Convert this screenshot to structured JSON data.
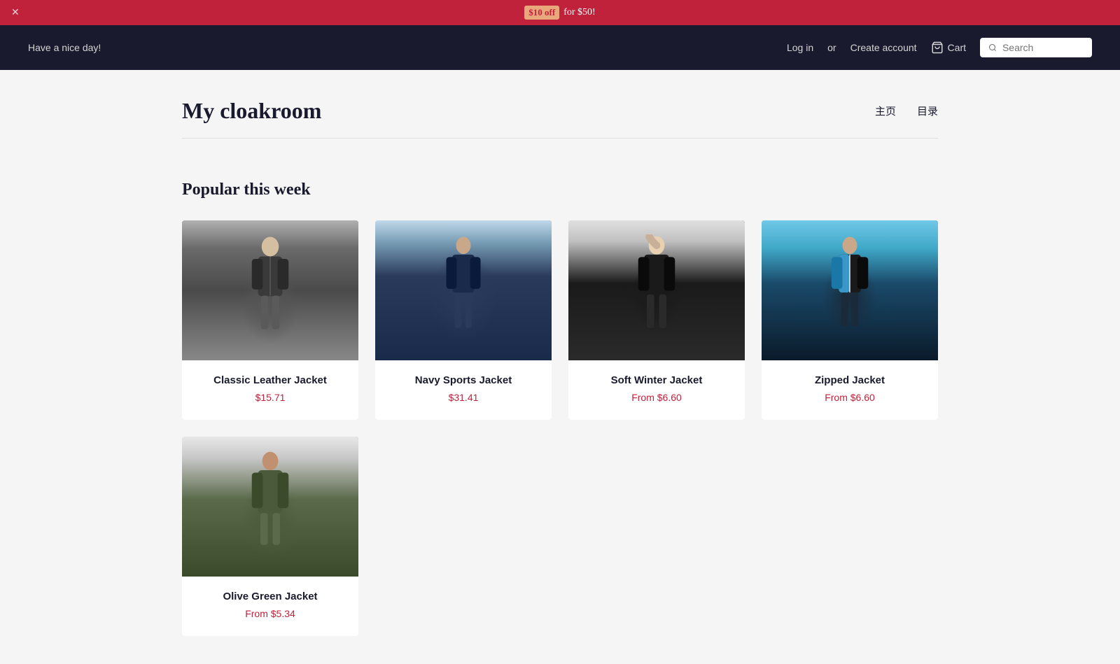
{
  "announcement": {
    "close_label": "✕",
    "pre_text": "",
    "discount_text": "$10 off",
    "post_text": "for $50!"
  },
  "navbar": {
    "greeting": "Have a nice day!",
    "login_label": "Log in",
    "or_label": "or",
    "create_account_label": "Create account",
    "cart_label": "Cart",
    "search_placeholder": "Search"
  },
  "store": {
    "title": "My cloakroom",
    "nav_home": "主页",
    "nav_catalog": "目录"
  },
  "popular_section": {
    "title": "Popular this week"
  },
  "products": [
    {
      "id": "classic-leather",
      "name": "Classic Leather Jacket",
      "price": "$15.71",
      "price_prefix": "",
      "image_class": "jacket-leather"
    },
    {
      "id": "navy-sports",
      "name": "Navy Sports Jacket",
      "price": "$31.41",
      "price_prefix": "",
      "image_class": "jacket-navy"
    },
    {
      "id": "soft-winter",
      "name": "Soft Winter Jacket",
      "price": "From $6.60",
      "price_prefix": "",
      "image_class": "jacket-winter"
    },
    {
      "id": "zipped-jacket",
      "name": "Zipped Jacket",
      "price": "From $6.60",
      "price_prefix": "",
      "image_class": "jacket-zipped"
    },
    {
      "id": "olive-green",
      "name": "Olive Green Jacket",
      "price": "From $5.34",
      "price_prefix": "",
      "image_class": "jacket-olive"
    }
  ]
}
